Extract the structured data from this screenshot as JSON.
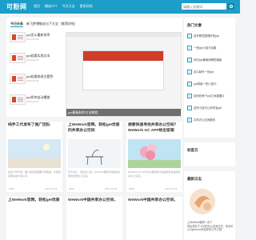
{
  "nav": {
    "logo": "可粉网",
    "links": [
      "首页",
      "精选PPT",
      "今天大全",
      "更多好帖"
    ],
    "search_placeholder": "请输入关键词"
  },
  "section": {
    "tabs": [
      "今日头条",
      "新飞梦想能站与下大全（推荐好帖）"
    ]
  },
  "list": [
    {
      "title": "ppt怎么重新排序",
      "sub": "2024-06-18"
    },
    {
      "title": "ppt若要实现文本",
      "sub": "2024-06-18"
    },
    {
      "title": "ppt若要修改主题色",
      "sub": "2024-06-18"
    },
    {
      "title": "ppt如何自动播放",
      "sub": "2024-06-18"
    }
  ],
  "featured": {
    "caption": "ppt模板制作方法教程"
  },
  "cards": [
    {
      "title": "纯手工代发布了推广团队",
      "desc": "在这个时代里，推广和运营需要与时俱进，才能获得更多用户的认可。",
      "views": "4389",
      "date": "2024-06-18"
    },
    {
      "title": "上WeWork官网，轻松get优质的共享办公空间",
      "desc": "足不出户，选好办公室。WeWork官网为你提供全球的优质办公空间。",
      "views": "6909",
      "date": "2024-06-18"
    },
    {
      "title": "想要快速寻找共享办公空间？WeWork GC APP给出答案",
      "desc": "WeWork GC APP可以帮助用户快速找到合适的共享办公空间。",
      "views": "6908",
      "date": "2024-06-18"
    }
  ],
  "cards_bottom": [
    {
      "title": "上WeWork官网，轻松get优质"
    },
    {
      "title": "WeWork中国共享办公空间，"
    },
    {
      "title": "WeWork中国共享办公空间，"
    }
  ],
  "sidebar": {
    "hot_title": "热门文章",
    "hot": [
      "这年帮您整理好的ppt",
      "一些ppt小技巧合集",
      "你们ppt都使用哪些模板",
      "这么制作一份ppt",
      "ppt排版一些小技巧",
      "如何在两个ppt之间插图片",
      "这些小技巧让你学会ppt",
      "共享办公空间服务"
    ],
    "tags_title": "标签云",
    "latest_title": "最新日志",
    "latest_line1": "上WeWork官网一天了",
    "latest_line2": "然后发布了人们的办公空间方式，你也可以Lightroom开启你的工作之旅！"
  },
  "colors": {
    "accent": "#1c9ec8",
    "ppt_red": "#d04a2f"
  }
}
